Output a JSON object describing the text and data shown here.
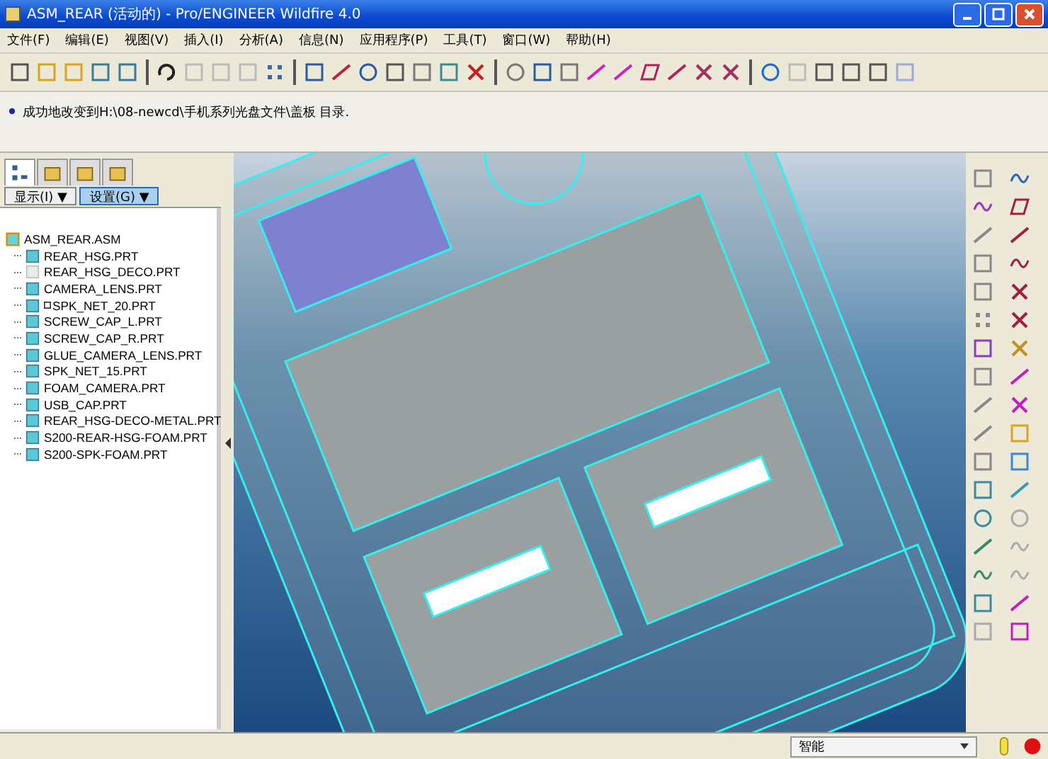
{
  "window": {
    "title": "ASM_REAR (活动的) - Pro/ENGINEER Wildfire 4.0"
  },
  "menu": [
    "文件(F)",
    "编辑(E)",
    "视图(V)",
    "插入(I)",
    "分析(A)",
    "信息(N)",
    "应用程序(P)",
    "工具(T)",
    "窗口(W)",
    "帮助(H)"
  ],
  "message": {
    "text": "成功地改变到H:\\08-newcd\\手机系列光盘文件\\盖板 目录."
  },
  "navigator_tabs": [
    {
      "selected": true
    },
    {
      "selected": false
    },
    {
      "selected": false
    },
    {
      "selected": false
    }
  ],
  "tree_buttons": [
    {
      "label": "显示(I) ▼",
      "selected": false
    },
    {
      "label": "设置(G) ▼",
      "selected": true
    }
  ],
  "model_tree": {
    "label": "ASM_REAR.ASM",
    "children": [
      {
        "label": "REAR_HSG.PRT",
        "hidden": false,
        "marked": false
      },
      {
        "label": "REAR_HSG_DECO.PRT",
        "hidden": true,
        "marked": false
      },
      {
        "label": "CAMERA_LENS.PRT",
        "hidden": false,
        "marked": false
      },
      {
        "label": "SPK_NET_20.PRT",
        "hidden": false,
        "marked": true
      },
      {
        "label": "SCREW_CAP_L.PRT",
        "hidden": false,
        "marked": false
      },
      {
        "label": "SCREW_CAP_R.PRT",
        "hidden": false,
        "marked": false
      },
      {
        "label": "GLUE_CAMERA_LENS.PRT",
        "hidden": false,
        "marked": false
      },
      {
        "label": "SPK_NET_15.PRT",
        "hidden": false,
        "marked": false
      },
      {
        "label": "FOAM_CAMERA.PRT",
        "hidden": false,
        "marked": false
      },
      {
        "label": "USB_CAP.PRT",
        "hidden": false,
        "marked": false
      },
      {
        "label": "REAR_HSG-DECO-METAL.PRT",
        "hidden": false,
        "marked": false
      },
      {
        "label": "S200-REAR-HSG-FOAM.PRT",
        "hidden": false,
        "marked": false
      },
      {
        "label": "S200-SPK-FOAM.PRT",
        "hidden": false,
        "marked": false
      }
    ]
  },
  "status_bar": {
    "filter": "智能"
  }
}
